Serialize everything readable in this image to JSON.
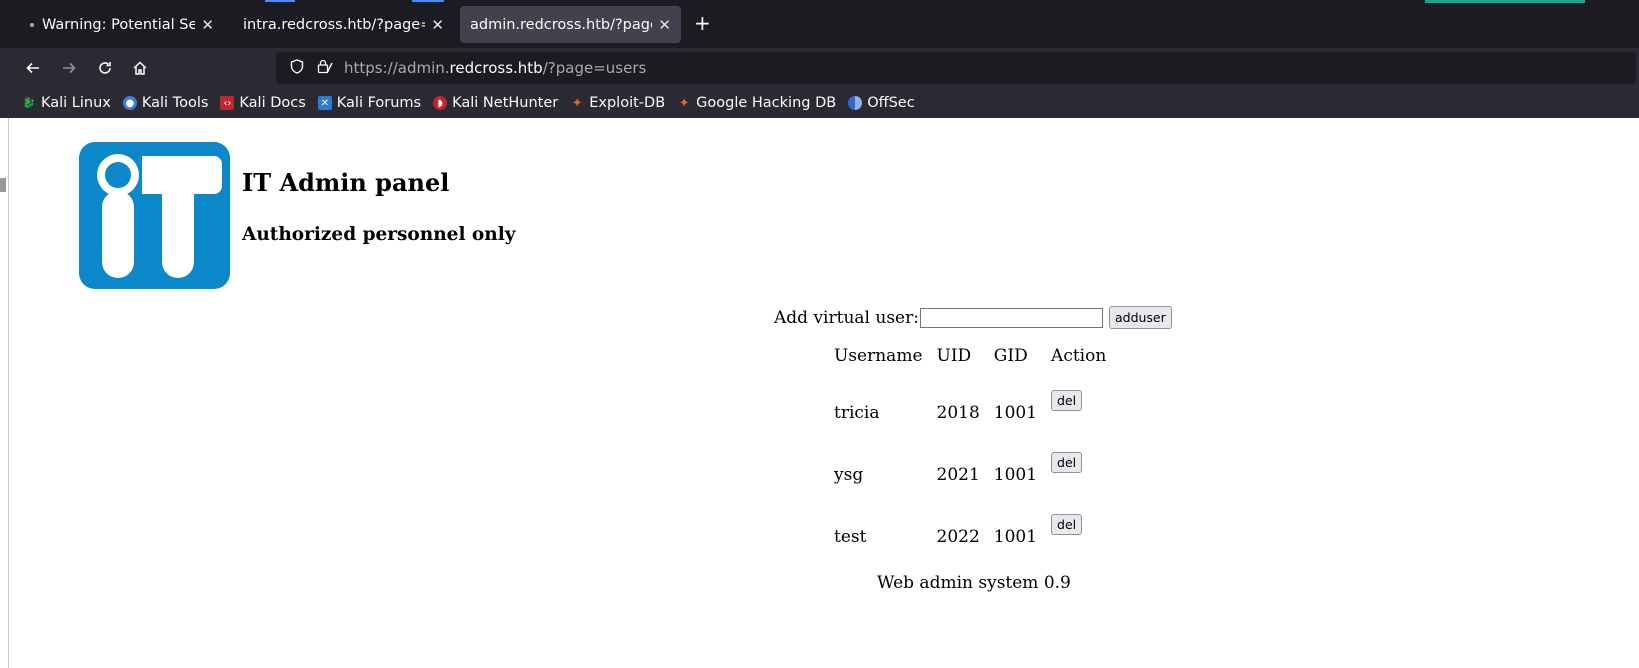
{
  "tabs": [
    {
      "title": "Warning: Potential Security Risk Ahead",
      "state": "inactive"
    },
    {
      "title": "intra.redcross.htb/?page=login",
      "state": "inactive"
    },
    {
      "title": "admin.redcross.htb/?page=users",
      "state": "active"
    }
  ],
  "new_tab_label": "+",
  "close_glyph": "✕",
  "url": {
    "prefix": "https://admin.",
    "host": "redcross.htb",
    "path": "/?page=users"
  },
  "bookmarks": [
    {
      "label": "Kali Linux",
      "icon": "kali-dragon-icon",
      "color": "#1a1a1a"
    },
    {
      "label": "Kali Tools",
      "icon": "kali-tools-icon",
      "color": "#3f7be0"
    },
    {
      "label": "Kali Docs",
      "icon": "kali-docs-icon",
      "color": "#c0262d"
    },
    {
      "label": "Kali Forums",
      "icon": "kali-forums-icon",
      "color": "#2d7ad8"
    },
    {
      "label": "Kali NetHunter",
      "icon": "nethunter-icon",
      "color": "#c0262d"
    },
    {
      "label": "Exploit-DB",
      "icon": "exploitdb-icon",
      "color": "#e8632b"
    },
    {
      "label": "Google Hacking DB",
      "icon": "ghdb-icon",
      "color": "#e8632b"
    },
    {
      "label": "OffSec",
      "icon": "offsec-icon",
      "color": "#3567c9"
    }
  ],
  "page": {
    "heading": "IT Admin panel",
    "subheading": "Authorized personnel only",
    "add_user_label": "Add virtual user:",
    "add_user_value": "",
    "add_user_button": "adduser",
    "table_headers": [
      "Username",
      "UID",
      "GID",
      "Action"
    ],
    "users": [
      {
        "username": "tricia",
        "uid": "2018",
        "gid": "1001",
        "action": "del"
      },
      {
        "username": "ysg",
        "uid": "2021",
        "gid": "1001",
        "action": "del"
      },
      {
        "username": "test",
        "uid": "2022",
        "gid": "1001",
        "action": "del"
      }
    ],
    "footer": "Web admin system 0.9",
    "logo_color": "#0a88c9"
  },
  "colors": {
    "chrome_dark": "#1c1b22",
    "toolbar": "#2b2a33",
    "active_tab": "#42414d",
    "accent": "#3d8eff"
  }
}
